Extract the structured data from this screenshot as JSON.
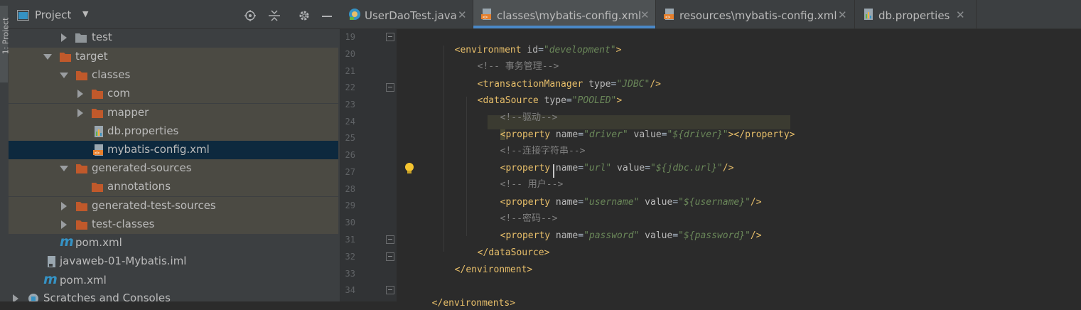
{
  "sidebar_stripe": {
    "label": "1: Project"
  },
  "project_panel": {
    "title": "Project",
    "tree": [
      {
        "label": "test",
        "icon": "folder-icon"
      },
      {
        "label": "target",
        "icon": "folder-icon"
      },
      {
        "label": "classes",
        "icon": "folder-icon"
      },
      {
        "label": "com",
        "icon": "folder-icon"
      },
      {
        "label": "mapper",
        "icon": "folder-icon"
      },
      {
        "label": "db.properties",
        "icon": "properties-file-icon"
      },
      {
        "label": "mybatis-config.xml",
        "icon": "xml-file-icon"
      },
      {
        "label": "generated-sources",
        "icon": "folder-icon"
      },
      {
        "label": "annotations",
        "icon": "folder-icon"
      },
      {
        "label": "generated-test-sources",
        "icon": "folder-icon"
      },
      {
        "label": "test-classes",
        "icon": "folder-icon"
      },
      {
        "label": "pom.xml",
        "icon": "maven-icon"
      },
      {
        "label": "javaweb-01-Mybatis.iml",
        "icon": "iml-file-icon"
      },
      {
        "label": "pom.xml",
        "icon": "maven-icon"
      },
      {
        "label": "Scratches and Consoles",
        "icon": "scratches-icon"
      }
    ]
  },
  "tabs": [
    {
      "label": "UserDaoTest.java",
      "icon": "java-class-icon",
      "close": "✕"
    },
    {
      "label": "classes\\mybatis-config.xml",
      "icon": "xml-file-icon",
      "close": "✕"
    },
    {
      "label": "resources\\mybatis-config.xml",
      "icon": "xml-file-icon",
      "close": "✕"
    },
    {
      "label": "db.properties",
      "icon": "properties-file-icon",
      "close": "✕"
    }
  ],
  "editor": {
    "line_numbers": [
      "19",
      "20",
      "21",
      "22",
      "23",
      "24",
      "25",
      "26",
      "27",
      "28",
      "29",
      "30",
      "31",
      "32",
      "33",
      "34"
    ],
    "lines": [
      {
        "open": "<",
        "tag": "environment",
        "a1": " id",
        "eq1": "=",
        "v1": "\"development\"",
        "close": ">"
      },
      {
        "comment": "<!-- 事务管理-->"
      },
      {
        "open": "<",
        "tag": "transactionManager",
        "a1": " type",
        "eq1": "=",
        "v1": "\"JDBC\"",
        "close": "/>"
      },
      {
        "open": "<",
        "tag": "dataSource",
        "a1": " type",
        "eq1": "=",
        "v1": "\"POOLED\"",
        "close": ">"
      },
      {
        "comment": "<!--驱动-->"
      },
      {
        "open": "<",
        "tag": "property",
        "a1": " name",
        "eq1": "=",
        "v1": "\"driver\"",
        "a2": " value",
        "eq2": "=",
        "v2": "\"${driver}\"",
        "close": "></property>"
      },
      {
        "comment": "<!--连接字符串-->"
      },
      {
        "open": "<",
        "tag": "property",
        "a1": " name",
        "eq1": "=",
        "v1": "\"url\"",
        "a2": " value",
        "eq2": "=",
        "v2": "\"${jdbc.url}\"",
        "close": "/>"
      },
      {
        "comment": "<!-- 用户-->"
      },
      {
        "open": "<",
        "tag": "property",
        "a1": " name",
        "eq1": "=",
        "v1": "\"username\"",
        "a2": " value",
        "eq2": "=",
        "v2": "\"${username}\"",
        "close": "/>"
      },
      {
        "comment": "<!--密码-->"
      },
      {
        "open": "<",
        "tag": "property",
        "a1": " name",
        "eq1": "=",
        "v1": "\"password\"",
        "a2": " value",
        "eq2": "=",
        "v2": "\"${password}\"",
        "close": "/>"
      },
      {
        "open": "</",
        "tag": "dataSource",
        "close": ">"
      },
      {
        "open": "</",
        "tag": "environment",
        "close": ">"
      },
      {},
      {
        "open": "</",
        "tag": "environments",
        "close": ">"
      }
    ]
  },
  "colors": {
    "accent": "#4a88c7",
    "folder": "#c0592b",
    "tag": "#e8bf6a",
    "value": "#6a8759",
    "comment": "#808080"
  }
}
